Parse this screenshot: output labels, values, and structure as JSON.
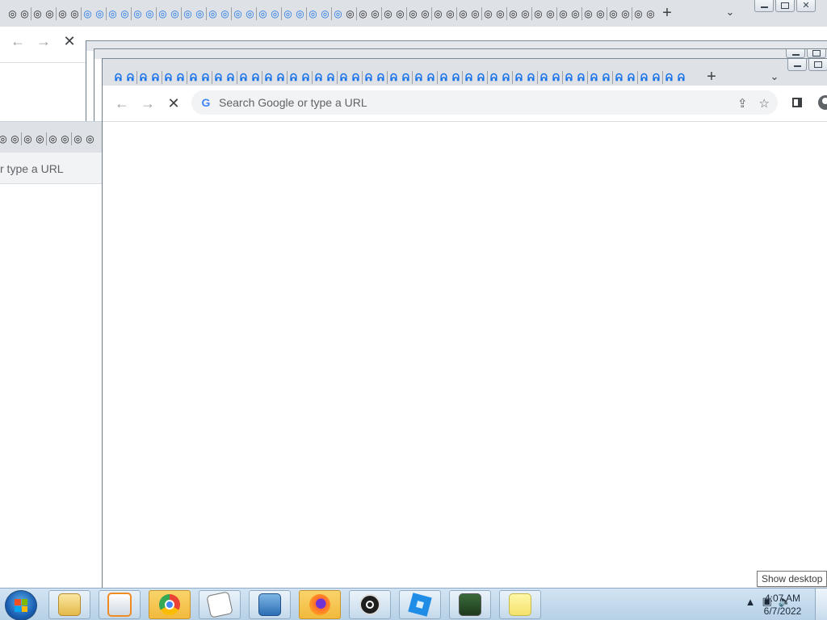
{
  "browser": {
    "omnibox_placeholder": "Search Google or type a URL",
    "omnibox_partial_left": "r type a URL",
    "new_tab_symbol": "+",
    "tab_list_symbol": "⌄",
    "back_symbol": "←",
    "forward_symbol": "→",
    "stop_symbol": "✕"
  },
  "window_controls": {
    "minimize": "",
    "restore": "",
    "close": "✕"
  },
  "taskbar": {
    "apps": [
      {
        "name": "file-explorer-icon"
      },
      {
        "name": "media-player-icon"
      },
      {
        "name": "chrome-icon"
      },
      {
        "name": "solitaire-icon"
      },
      {
        "name": "control-panel-icon"
      },
      {
        "name": "firefox-icon"
      },
      {
        "name": "obs-icon"
      },
      {
        "name": "roblox-icon"
      },
      {
        "name": "task-manager-icon"
      },
      {
        "name": "sticky-notes-icon"
      }
    ],
    "clock_time": "4:07 AM",
    "clock_date": "6/7/2022",
    "tooltip": "Show desktop"
  },
  "colors": {
    "accent": "#1a73e8",
    "tabstrip": "#dee1e6",
    "taskbar": "#b6d0e6"
  }
}
